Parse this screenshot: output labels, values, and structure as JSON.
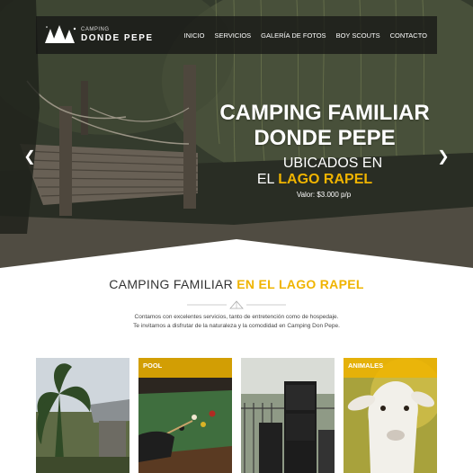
{
  "nav": {
    "logo_small": "CAMPING",
    "logo_big": "DONDE PEPE",
    "items": [
      {
        "label": "INICIO"
      },
      {
        "label": "SERVICIOS"
      },
      {
        "label": "GALERÍA DE FOTOS"
      },
      {
        "label": "BOY SCOUTS"
      },
      {
        "label": "CONTACTO"
      }
    ]
  },
  "hero": {
    "title_line1": "CAMPING FAMILIAR",
    "title_line2": "DONDE PEPE",
    "sub_line1": "UBICADOS EN",
    "sub_line2_prefix": "EL ",
    "sub_line2_accent": "LAGO RAPEL",
    "price": "Valor: $3.000 p/p",
    "prev_icon": "chevron-left-icon",
    "next_icon": "chevron-right-icon"
  },
  "section": {
    "title_prefix": "CAMPING FAMILIAR ",
    "title_accent": "EN EL LAGO RAPEL",
    "intro_line1": "Contamos con excelentes servicios, tanto de entretención como de hospedaje.",
    "intro_line2": "Te invitamos a disfrutar de la naturaleza y la comodidad en Camping Don Pepe."
  },
  "cards": [
    {
      "label": ""
    },
    {
      "label": "POOL"
    },
    {
      "label": ""
    },
    {
      "label": "ANIMALES"
    }
  ],
  "colors": {
    "accent": "#f0b400",
    "nav_bg": "#141414",
    "text_dark": "#333333"
  }
}
